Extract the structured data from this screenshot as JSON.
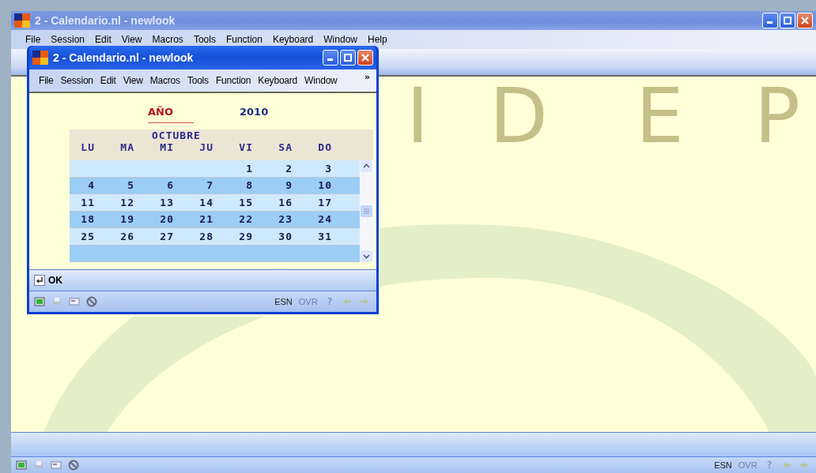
{
  "main_window": {
    "title": "2 - Calendario.nl - newlook",
    "menu": [
      "File",
      "Session",
      "Edit",
      "View",
      "Macros",
      "Tools",
      "Function",
      "Keyboard",
      "Window",
      "Help"
    ],
    "status": {
      "language": "ESN",
      "overwrite": "OVR",
      "help": "?"
    }
  },
  "background_letters": [
    "I",
    "D",
    "E",
    "P"
  ],
  "dialog": {
    "title": "2 - Calendario.nl - newlook",
    "menu": [
      "File",
      "Session",
      "Edit",
      "View",
      "Macros",
      "Tools",
      "Function",
      "Keyboard",
      "Window"
    ],
    "more": "»",
    "year_label": "AÑO",
    "year": "2010",
    "month": "OCTUBRE",
    "weekdays": [
      "LU",
      "MA",
      "MI",
      "JU",
      "VI",
      "SA",
      "DO"
    ],
    "weeks": [
      [
        "1",
        "2",
        "3"
      ],
      [
        "4",
        "5",
        "6",
        "7",
        "8",
        "9",
        "10"
      ],
      [
        "11",
        "12",
        "13",
        "14",
        "15",
        "16",
        "17"
      ],
      [
        "18",
        "19",
        "20",
        "21",
        "22",
        "23",
        "24"
      ],
      [
        "25",
        "26",
        "27",
        "28",
        "29",
        "30",
        "31"
      ]
    ],
    "ok": "OK",
    "status": {
      "language": "ESN",
      "overwrite": "OVR",
      "help": "?"
    }
  }
}
